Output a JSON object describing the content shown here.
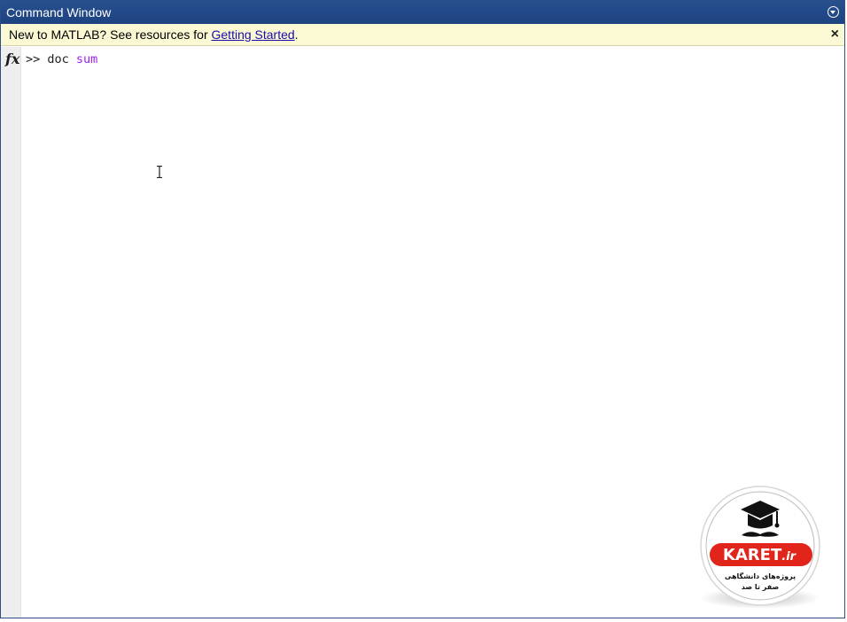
{
  "window": {
    "title": "Command Window",
    "accent_color": "#1d4280"
  },
  "banner": {
    "text": "New to MATLAB? See resources for ",
    "link_text": "Getting Started",
    "suffix": ".",
    "close_symbol": "×",
    "background_color": "#fbf8d4"
  },
  "command": {
    "fx_label": "fx",
    "prompt": ">> ",
    "text": "doc ",
    "argument": "sum",
    "argument_color": "#a020f0"
  },
  "watermark": {
    "brand": "KARET",
    "domain_suffix": ".ir",
    "tagline_1": "پروژه‌های دانشگاهی",
    "tagline_2": "صفر تا صد"
  },
  "icons": {
    "title_menu": "chevron-down-circle-icon",
    "close": "close-icon",
    "cursor": "text-cursor-icon",
    "logo": "graduation-cap-icon"
  }
}
